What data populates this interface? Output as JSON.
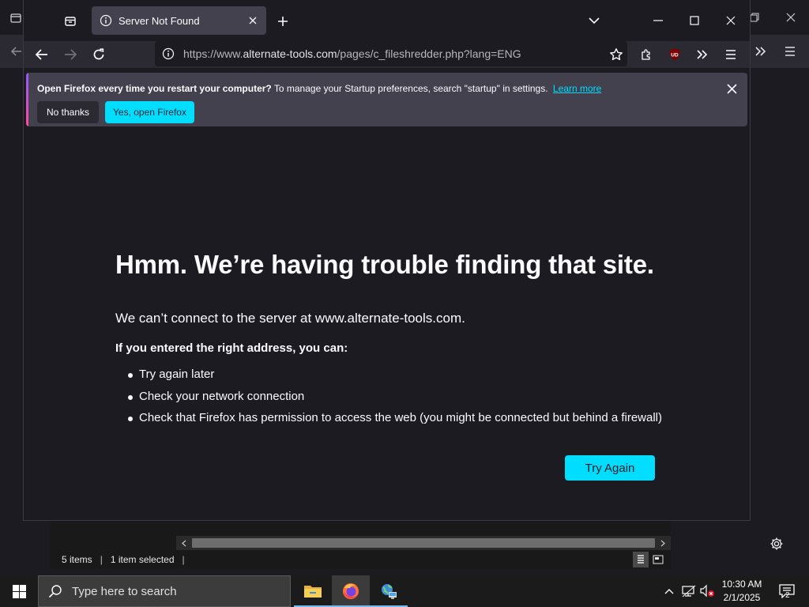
{
  "browser": {
    "tab": {
      "title": "Server Not Found"
    },
    "url": {
      "prefix": "https://www.",
      "domain": "alternate-tools.com",
      "path": "/pages/c_fileshredder.php?lang=ENG"
    },
    "extension_badge": "UD"
  },
  "notification": {
    "bold_text": "Open Firefox every time you restart your computer?",
    "text": " To manage your Startup preferences, search \"startup\" in settings.",
    "learn_more": "Learn more",
    "no_button": "No thanks",
    "yes_button": "Yes, open Firefox"
  },
  "error_page": {
    "title": "Hmm. We’re having trouble finding that site.",
    "description": "We can’t connect to the server at www.alternate-tools.com.",
    "subtitle": "If you entered the right address, you can:",
    "suggestions": [
      "Try again later",
      "Check your network connection",
      "Check that Firefox has permission to access the web (you might be connected but behind a firewall)"
    ],
    "try_again": "Try Again"
  },
  "explorer": {
    "items_count": "5 items",
    "selection": "1 item selected"
  },
  "taskbar": {
    "search_placeholder": "Type here to search",
    "time": "10:30 AM",
    "date": "2/1/2025",
    "notification_count": "2"
  },
  "colors": {
    "accent": "#00ddff",
    "page_background": "#1c1b22",
    "toolbar": "#2b2a33",
    "notification_bar": "#42414d"
  }
}
